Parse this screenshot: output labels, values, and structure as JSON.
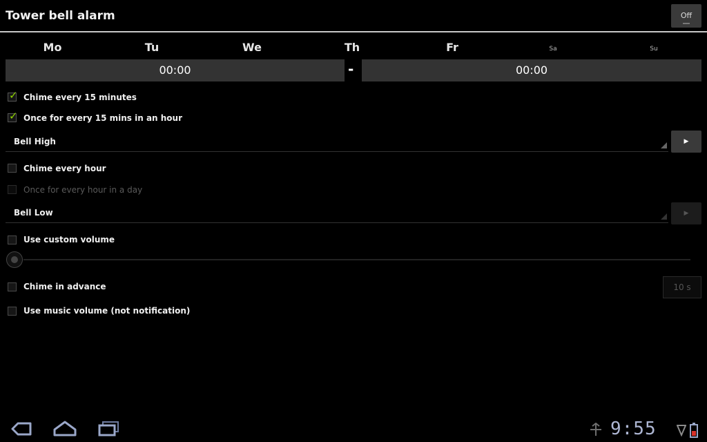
{
  "header": {
    "title": "Tower bell alarm",
    "toggle_label": "Off"
  },
  "days": [
    {
      "label": "Mo",
      "small": false
    },
    {
      "label": "Tu",
      "small": false
    },
    {
      "label": "We",
      "small": false
    },
    {
      "label": "Th",
      "small": false
    },
    {
      "label": "Fr",
      "small": false
    },
    {
      "label": "Sa",
      "small": true
    },
    {
      "label": "Su",
      "small": true
    }
  ],
  "time_range": {
    "start": "00:00",
    "separator": "-",
    "end": "00:00"
  },
  "options": {
    "chime_15": {
      "label": "Chime every 15 minutes",
      "checked": true
    },
    "once_15": {
      "label": "Once for every 15 mins in an hour",
      "checked": true
    },
    "bell_high": {
      "label": "Bell High"
    },
    "chime_hour": {
      "label": "Chime every hour",
      "checked": false
    },
    "once_hour": {
      "label": "Once for every hour in a day",
      "checked": false,
      "disabled": true
    },
    "bell_low": {
      "label": "Bell Low"
    },
    "custom_volume": {
      "label": "Use custom volume",
      "checked": false
    },
    "chime_advance": {
      "label": "Chime in advance",
      "checked": false
    },
    "advance_value": "10 s",
    "music_volume": {
      "label": "Use music volume (not notification)",
      "checked": false
    }
  },
  "play_button_label": "▶",
  "status_bar": {
    "time": "9:55"
  },
  "colors": {
    "check_accent": "#8fd400",
    "clock": "#aeb7d4",
    "title_rule": "#c8c8c8"
  }
}
